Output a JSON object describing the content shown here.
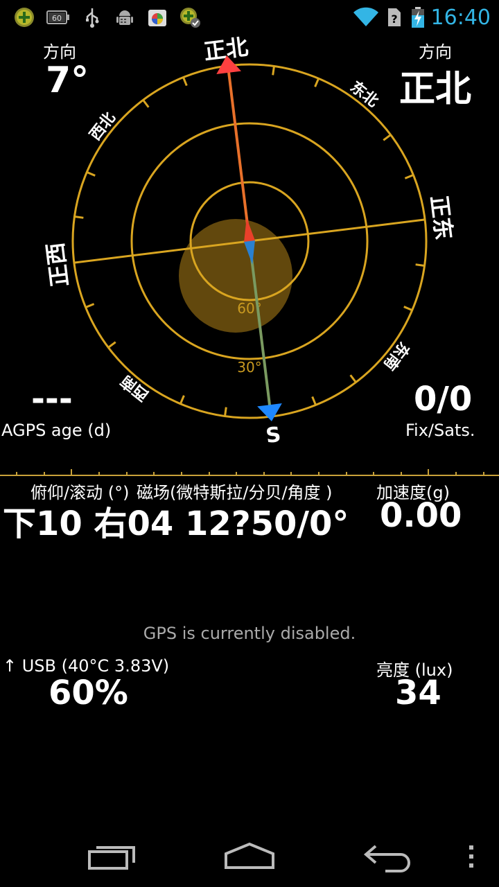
{
  "status_bar": {
    "time": "16:40",
    "icons": [
      "plus-circle-icon",
      "battery-60-icon",
      "usb-icon",
      "android-debug-icon",
      "app-store-icon",
      "update-check-icon"
    ],
    "right_icons": [
      "wifi-icon",
      "no-sim-icon",
      "battery-charging-icon"
    ],
    "battery_text": "60",
    "clock_color": "#33b5e5"
  },
  "compass": {
    "heading_label_left": "方向",
    "heading_value_left": "7°",
    "heading_label_right": "方向",
    "heading_value_right": "正北",
    "dir_n": "正北",
    "dir_ne": "东北",
    "dir_e": "正东",
    "dir_se": "东南",
    "dir_s": "S",
    "dir_sw": "西南",
    "dir_w": "正西",
    "dir_nw": "西北",
    "ring_60": "60°",
    "ring_30": "30°",
    "ring_color": "#d9a520",
    "north_color": "#ff3b3b",
    "south_color": "#1e88ff"
  },
  "agps": {
    "value": "---",
    "label": "AGPS age (d)"
  },
  "fix": {
    "value": "0/0",
    "label": "Fix/Sats."
  },
  "sensors": {
    "pitch_roll_label": "俯仰/滚动 (°)",
    "magnetic_label": "磁场(微特斯拉/分贝/角度 )",
    "accel_label": "加速度(g)",
    "values_text": "下10 右04 12?50/0°",
    "accel_value": "0.00"
  },
  "gps_status": "GPS is currently disabled.",
  "battery": {
    "label": "↑ USB (40°C 3.83V)",
    "value": "60%"
  },
  "light": {
    "label": "亮度 (lux)",
    "value": "34"
  },
  "navbar": {
    "buttons": [
      "recent-apps-icon",
      "home-icon",
      "back-icon",
      "menu-icon"
    ]
  }
}
